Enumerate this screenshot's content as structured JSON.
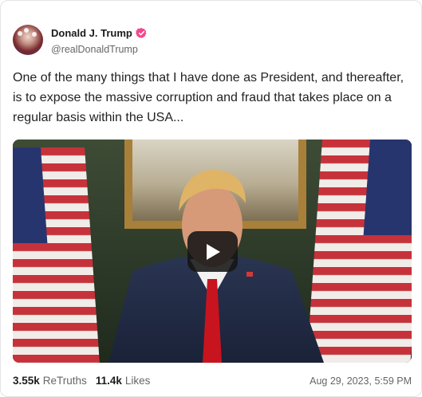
{
  "author": {
    "display_name": "Donald J. Trump",
    "handle": "@realDonaldTrump",
    "verified_badge_icon": "verified-check-badge",
    "badge_color": "#f5468f"
  },
  "post": {
    "text": "One of the many things that I have done as President, and thereafter, is to expose the massive corruption and fraud that takes place on a regular basis within the USA...",
    "media": {
      "type": "video",
      "play_icon": "play-icon"
    }
  },
  "stats": {
    "retruths_count": "3.55k",
    "retruths_label": "ReTruths",
    "likes_count": "11.4k",
    "likes_label": "Likes"
  },
  "timestamp": "Aug 29, 2023, 5:59 PM"
}
